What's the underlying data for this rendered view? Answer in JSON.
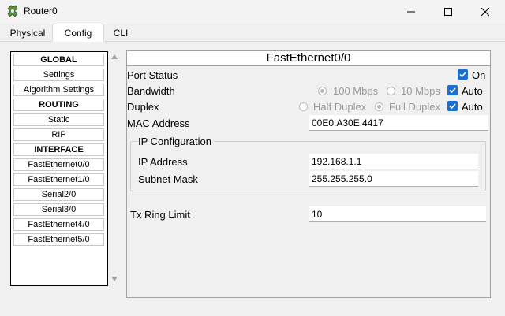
{
  "window": {
    "title": "Router0",
    "icon": "router-icon"
  },
  "tabs": [
    {
      "label": "Physical",
      "active": false
    },
    {
      "label": "Config",
      "active": true
    },
    {
      "label": "CLI",
      "active": false
    }
  ],
  "sidebar": {
    "items": [
      {
        "label": "GLOBAL",
        "header": true
      },
      {
        "label": "Settings",
        "header": false
      },
      {
        "label": "Algorithm Settings",
        "header": false
      },
      {
        "label": "ROUTING",
        "header": true
      },
      {
        "label": "Static",
        "header": false
      },
      {
        "label": "RIP",
        "header": false
      },
      {
        "label": "INTERFACE",
        "header": true
      },
      {
        "label": "FastEthernet0/0",
        "header": false
      },
      {
        "label": "FastEthernet1/0",
        "header": false
      },
      {
        "label": "Serial2/0",
        "header": false
      },
      {
        "label": "Serial3/0",
        "header": false
      },
      {
        "label": "FastEthernet4/0",
        "header": false
      },
      {
        "label": "FastEthernet5/0",
        "header": false
      }
    ]
  },
  "panel": {
    "title": "FastEthernet0/0",
    "port_status": {
      "label": "Port Status",
      "on_label": "On",
      "on_checked": true
    },
    "bandwidth": {
      "label": "Bandwidth",
      "opt_100": "100 Mbps",
      "opt_10": "10 Mbps",
      "auto_label": "Auto",
      "auto_checked": true
    },
    "duplex": {
      "label": "Duplex",
      "opt_half": "Half Duplex",
      "opt_full": "Full Duplex",
      "auto_label": "Auto",
      "auto_checked": true
    },
    "mac": {
      "label": "MAC Address",
      "value": "00E0.A30E.4417"
    },
    "ip_config": {
      "title": "IP Configuration",
      "ip_label": "IP Address",
      "ip_value": "192.168.1.1",
      "mask_label": "Subnet Mask",
      "mask_value": "255.255.255.0"
    },
    "tx_ring": {
      "label": "Tx Ring Limit",
      "value": "10"
    }
  },
  "colors": {
    "check_blue": "#1a6fd1",
    "disabled_text": "#9a9a9a"
  }
}
